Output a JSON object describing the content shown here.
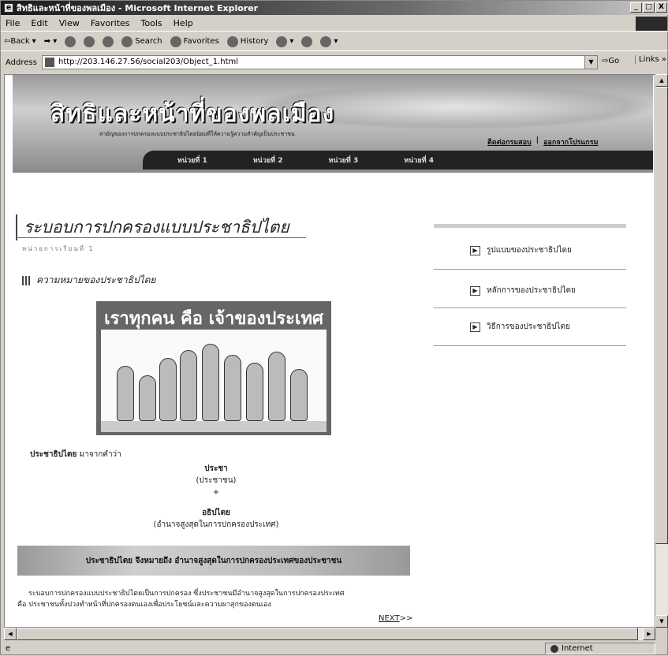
{
  "window": {
    "title": "สิทธิและหน้าที่ของพลเมือง - Microsoft Internet Explorer",
    "buttons": [
      "_",
      "□",
      "X"
    ]
  },
  "menu": [
    "File",
    "Edit",
    "View",
    "Favorites",
    "Tools",
    "Help"
  ],
  "toolbar": {
    "back": "⇦Back",
    "search": "Search",
    "favorites": "Favorites",
    "history": "History"
  },
  "address": {
    "label": "Address",
    "url": "http://203.146.27.56/social203/Object_1.html",
    "go": "Go",
    "links": "Links »"
  },
  "banner": {
    "title": "สิทธิและหน้าที่ของพลเมือง",
    "subtitle": "สามัญของการปกครองแบบประชาธิปไตยนิยมที่ให้ความรู้ความสำคัญเป็นประชาชน",
    "contact": "ติดต่อกรมสอบ",
    "exit": "ออกจากโปรแกรม",
    "nav": [
      "หน่วยที่ 1",
      "หน่วยที่ 2",
      "หน่วยที่ 3",
      "หน่วยที่ 4"
    ]
  },
  "page": {
    "title": "ระบอบการปกครองแบบประชาธิปไตย",
    "subcaption": "หน่วยการเรียนที่ 1",
    "section": "ความหมายของประชาธิปไตย",
    "poster_title": "เราทุกคน คือ เจ้าของประเทศ",
    "demo_word": "ประชาธิปไตย",
    "demo_from": "มาจากคำว่า",
    "part1_word": "ประชา",
    "part1_meaning": "(ประชาชน)",
    "plus": "+",
    "part2_word": "อธิปไตย",
    "part2_meaning": "(อำนาจสูงสุดในการปกครองประเทศ)",
    "banner2": "ประชาธิปไตย จึงหมายถึง อำนาจสูงสุดในการปกครองประเทศของประชาชน",
    "para_line1": "ระบอบการปกครองแบบประชาธิปไตยเป็นการปกครอง ซึ่งประชาชนมีอำนาจสูงสุดในการปกครองประเทศ",
    "para_line2": "คือ ประชาชนทั้งปวงทำหน้าที่ปกครองตนเองเพื่อประโยชน์และความผาสุกของตนเอง",
    "next": "NEXT",
    "next_suffix": ">>"
  },
  "side_menu": [
    {
      "label": "รูปแบบของประชาธิปไตย"
    },
    {
      "label": "หลักการของประชาธิปไตย"
    },
    {
      "label": "วิธีการของประชาธิปไตย"
    }
  ],
  "status": {
    "zone": "Internet"
  }
}
